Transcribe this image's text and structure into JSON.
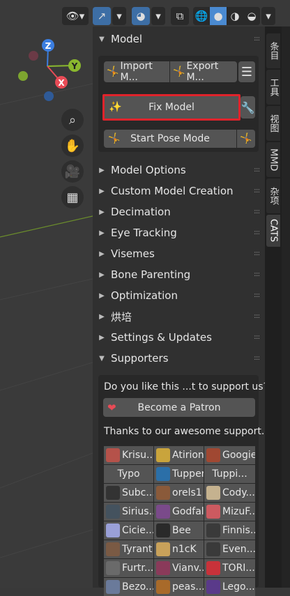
{
  "panel": {
    "model_header": "Model",
    "import_label": "Import M...",
    "export_label": "Export M...",
    "fix_model_label": "Fix Model",
    "start_pose_label": "Start Pose Mode"
  },
  "sections": [
    "Model Options",
    "Custom Model Creation",
    "Decimation",
    "Eye Tracking",
    "Visemes",
    "Bone Parenting",
    "Optimization",
    "烘培",
    "Settings & Updates",
    "Supporters"
  ],
  "supporters": {
    "question": "Do you like this ...t to support us?",
    "patron_button": "Become a Patron",
    "thanks": "Thanks to our awesome support..."
  },
  "patrons": [
    [
      "Krisu....",
      "Atirion",
      "Googie"
    ],
    [
      "Typo",
      "Tupper",
      "Tuppi..."
    ],
    [
      "Subc...",
      "orels1",
      "Cody..."
    ],
    [
      "Sirius...",
      "Godfall",
      "MizuF..."
    ],
    [
      "Cicie...",
      "Bee",
      "Finnis..."
    ],
    [
      "Tyrant",
      "n1cK",
      "Even..."
    ],
    [
      "Furtr...",
      "Vianv...",
      "TORI..."
    ],
    [
      "Bezo...",
      "peas...",
      "Lego..."
    ]
  ],
  "tabs": [
    "条目",
    "工具",
    "视图",
    "MMD",
    "杂项",
    "CATS"
  ],
  "gizmo": {
    "z": "Z",
    "y": "Y",
    "x": "X"
  },
  "colors": {
    "accent": "#4a8ad1",
    "highlight_border": "#e0232b",
    "x_axis": "#e84b56",
    "y_axis": "#8ab82e",
    "z_axis": "#3b7ee0"
  }
}
